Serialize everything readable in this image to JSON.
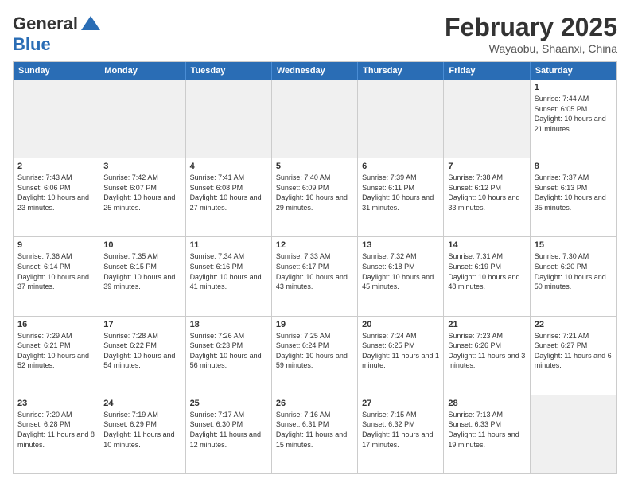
{
  "header": {
    "logo_general": "General",
    "logo_blue": "Blue",
    "month_title": "February 2025",
    "location": "Wayaobu, Shaanxi, China"
  },
  "weekdays": [
    "Sunday",
    "Monday",
    "Tuesday",
    "Wednesday",
    "Thursday",
    "Friday",
    "Saturday"
  ],
  "rows": [
    [
      {
        "day": "",
        "text": "",
        "shaded": true
      },
      {
        "day": "",
        "text": "",
        "shaded": true
      },
      {
        "day": "",
        "text": "",
        "shaded": true
      },
      {
        "day": "",
        "text": "",
        "shaded": true
      },
      {
        "day": "",
        "text": "",
        "shaded": true
      },
      {
        "day": "",
        "text": "",
        "shaded": true
      },
      {
        "day": "1",
        "text": "Sunrise: 7:44 AM\nSunset: 6:05 PM\nDaylight: 10 hours and 21 minutes.",
        "shaded": false
      }
    ],
    [
      {
        "day": "2",
        "text": "Sunrise: 7:43 AM\nSunset: 6:06 PM\nDaylight: 10 hours and 23 minutes.",
        "shaded": false
      },
      {
        "day": "3",
        "text": "Sunrise: 7:42 AM\nSunset: 6:07 PM\nDaylight: 10 hours and 25 minutes.",
        "shaded": false
      },
      {
        "day": "4",
        "text": "Sunrise: 7:41 AM\nSunset: 6:08 PM\nDaylight: 10 hours and 27 minutes.",
        "shaded": false
      },
      {
        "day": "5",
        "text": "Sunrise: 7:40 AM\nSunset: 6:09 PM\nDaylight: 10 hours and 29 minutes.",
        "shaded": false
      },
      {
        "day": "6",
        "text": "Sunrise: 7:39 AM\nSunset: 6:11 PM\nDaylight: 10 hours and 31 minutes.",
        "shaded": false
      },
      {
        "day": "7",
        "text": "Sunrise: 7:38 AM\nSunset: 6:12 PM\nDaylight: 10 hours and 33 minutes.",
        "shaded": false
      },
      {
        "day": "8",
        "text": "Sunrise: 7:37 AM\nSunset: 6:13 PM\nDaylight: 10 hours and 35 minutes.",
        "shaded": false
      }
    ],
    [
      {
        "day": "9",
        "text": "Sunrise: 7:36 AM\nSunset: 6:14 PM\nDaylight: 10 hours and 37 minutes.",
        "shaded": false
      },
      {
        "day": "10",
        "text": "Sunrise: 7:35 AM\nSunset: 6:15 PM\nDaylight: 10 hours and 39 minutes.",
        "shaded": false
      },
      {
        "day": "11",
        "text": "Sunrise: 7:34 AM\nSunset: 6:16 PM\nDaylight: 10 hours and 41 minutes.",
        "shaded": false
      },
      {
        "day": "12",
        "text": "Sunrise: 7:33 AM\nSunset: 6:17 PM\nDaylight: 10 hours and 43 minutes.",
        "shaded": false
      },
      {
        "day": "13",
        "text": "Sunrise: 7:32 AM\nSunset: 6:18 PM\nDaylight: 10 hours and 45 minutes.",
        "shaded": false
      },
      {
        "day": "14",
        "text": "Sunrise: 7:31 AM\nSunset: 6:19 PM\nDaylight: 10 hours and 48 minutes.",
        "shaded": false
      },
      {
        "day": "15",
        "text": "Sunrise: 7:30 AM\nSunset: 6:20 PM\nDaylight: 10 hours and 50 minutes.",
        "shaded": false
      }
    ],
    [
      {
        "day": "16",
        "text": "Sunrise: 7:29 AM\nSunset: 6:21 PM\nDaylight: 10 hours and 52 minutes.",
        "shaded": false
      },
      {
        "day": "17",
        "text": "Sunrise: 7:28 AM\nSunset: 6:22 PM\nDaylight: 10 hours and 54 minutes.",
        "shaded": false
      },
      {
        "day": "18",
        "text": "Sunrise: 7:26 AM\nSunset: 6:23 PM\nDaylight: 10 hours and 56 minutes.",
        "shaded": false
      },
      {
        "day": "19",
        "text": "Sunrise: 7:25 AM\nSunset: 6:24 PM\nDaylight: 10 hours and 59 minutes.",
        "shaded": false
      },
      {
        "day": "20",
        "text": "Sunrise: 7:24 AM\nSunset: 6:25 PM\nDaylight: 11 hours and 1 minute.",
        "shaded": false
      },
      {
        "day": "21",
        "text": "Sunrise: 7:23 AM\nSunset: 6:26 PM\nDaylight: 11 hours and 3 minutes.",
        "shaded": false
      },
      {
        "day": "22",
        "text": "Sunrise: 7:21 AM\nSunset: 6:27 PM\nDaylight: 11 hours and 6 minutes.",
        "shaded": false
      }
    ],
    [
      {
        "day": "23",
        "text": "Sunrise: 7:20 AM\nSunset: 6:28 PM\nDaylight: 11 hours and 8 minutes.",
        "shaded": false
      },
      {
        "day": "24",
        "text": "Sunrise: 7:19 AM\nSunset: 6:29 PM\nDaylight: 11 hours and 10 minutes.",
        "shaded": false
      },
      {
        "day": "25",
        "text": "Sunrise: 7:17 AM\nSunset: 6:30 PM\nDaylight: 11 hours and 12 minutes.",
        "shaded": false
      },
      {
        "day": "26",
        "text": "Sunrise: 7:16 AM\nSunset: 6:31 PM\nDaylight: 11 hours and 15 minutes.",
        "shaded": false
      },
      {
        "day": "27",
        "text": "Sunrise: 7:15 AM\nSunset: 6:32 PM\nDaylight: 11 hours and 17 minutes.",
        "shaded": false
      },
      {
        "day": "28",
        "text": "Sunrise: 7:13 AM\nSunset: 6:33 PM\nDaylight: 11 hours and 19 minutes.",
        "shaded": false
      },
      {
        "day": "",
        "text": "",
        "shaded": true
      }
    ]
  ]
}
